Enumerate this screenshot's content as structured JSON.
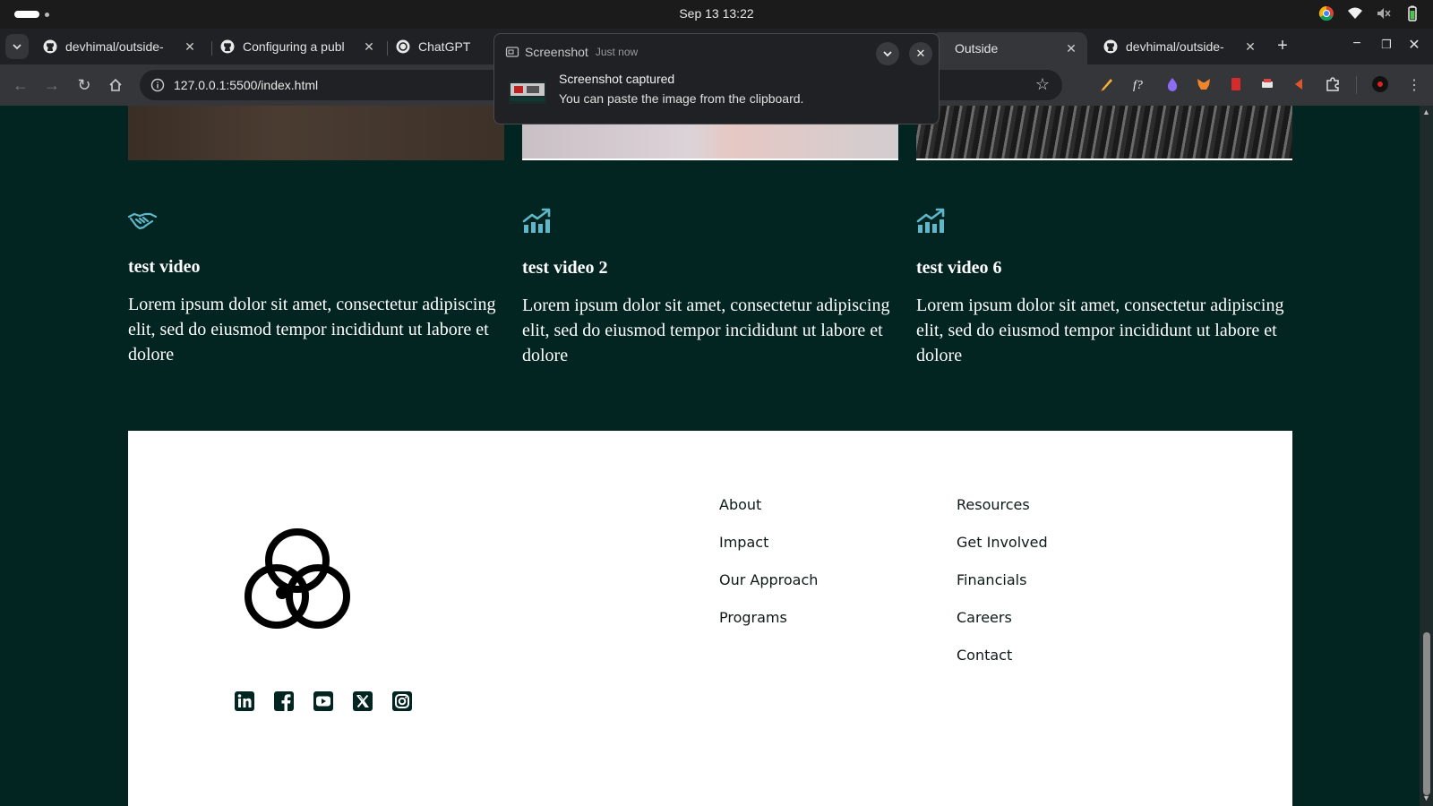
{
  "os": {
    "clock": "Sep 13  13:22"
  },
  "tabs": [
    {
      "title": "devhimal/outside-",
      "icon": "github-icon"
    },
    {
      "title": "Configuring a publ",
      "icon": "github-icon"
    },
    {
      "title": "ChatGPT",
      "icon": "chatgpt-icon"
    },
    {
      "title": "Outside",
      "icon": "page-icon",
      "active": true
    },
    {
      "title": "devhimal/outside-",
      "icon": "github-icon"
    }
  ],
  "toolbar": {
    "url": "127.0.0.1:5500/index.html"
  },
  "notification": {
    "app": "Screenshot",
    "when": "Just now",
    "title": "Screenshot captured",
    "body": "You can paste the image from the clipboard."
  },
  "cards": [
    {
      "title": "test video",
      "desc": "Lorem ipsum dolor sit amet, consectetur adipiscing elit, sed do eiusmod tempor incididunt ut labore et dolore",
      "icon": "handshake-icon"
    },
    {
      "title": "test video 2",
      "desc": "Lorem ipsum dolor sit amet, consectetur adipiscing elit, sed do eiusmod tempor incididunt ut labore et dolore",
      "icon": "growth-chart-icon"
    },
    {
      "title": "test video 6",
      "desc": "Lorem ipsum dolor sit amet, consectetur adipiscing elit, sed do eiusmod tempor incididunt ut labore et dolore",
      "icon": "growth-chart-icon"
    }
  ],
  "footer": {
    "col1": [
      "About",
      "Impact",
      "Our Approach",
      "Programs"
    ],
    "col2": [
      "Resources",
      "Get Involved",
      "Financials",
      "Careers",
      "Contact"
    ],
    "socials": [
      "linkedin-icon",
      "facebook-icon",
      "youtube-icon",
      "x-icon",
      "instagram-icon"
    ]
  },
  "colors": {
    "page_bg": "#022522",
    "accent_icon": "#5fb7c9",
    "footer_bg": "#ffffff"
  }
}
